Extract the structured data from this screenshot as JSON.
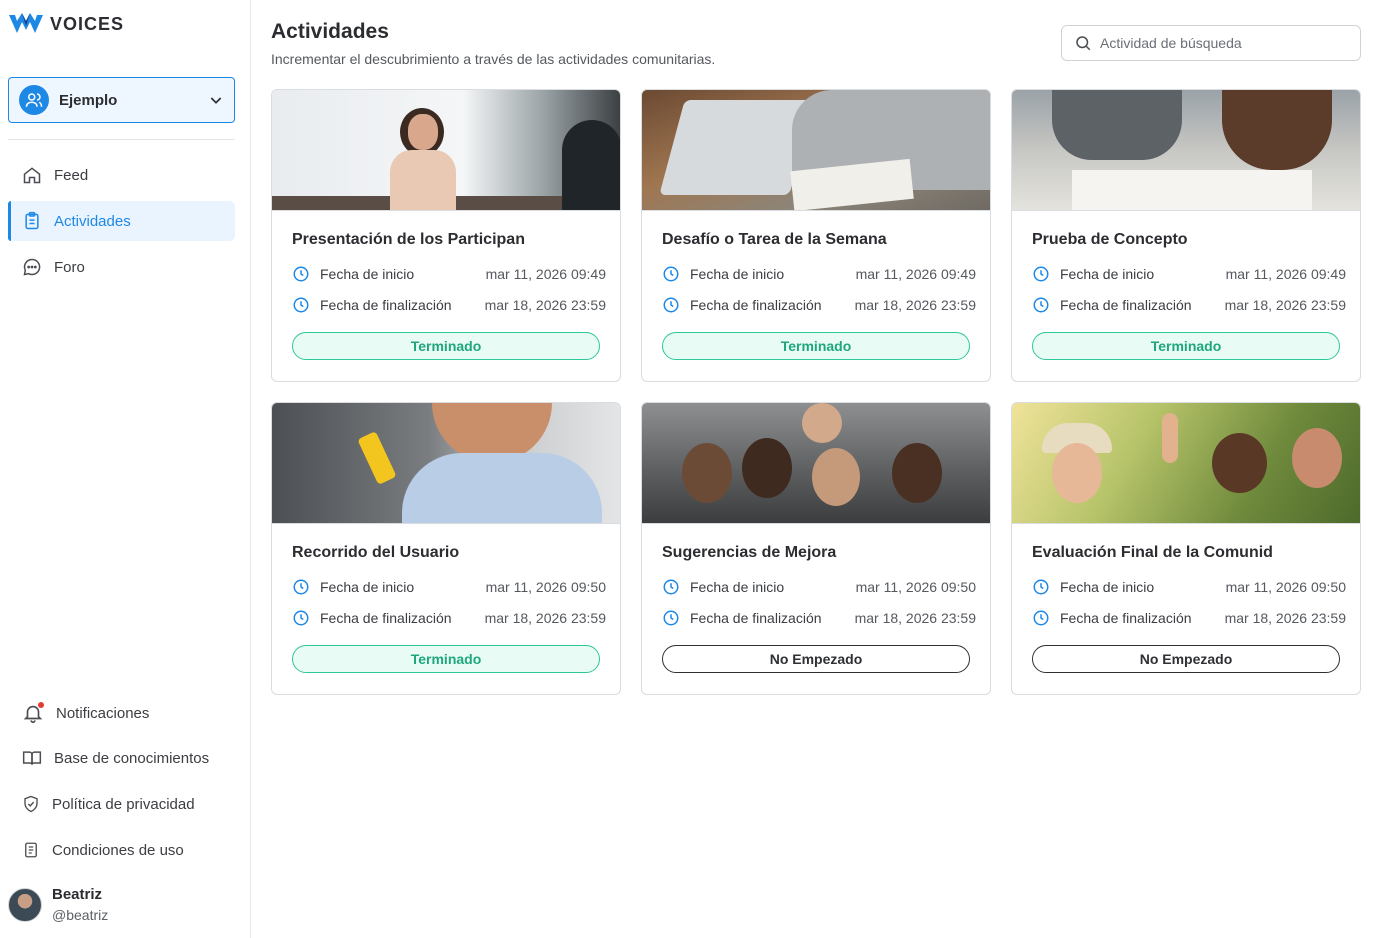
{
  "app": {
    "name": "VOICES"
  },
  "community": {
    "label": "Ejemplo"
  },
  "nav": [
    {
      "id": "feed",
      "label": "Feed",
      "icon": "home-icon",
      "active": false
    },
    {
      "id": "actividades",
      "label": "Actividades",
      "icon": "clipboard-icon",
      "active": true
    },
    {
      "id": "foro",
      "label": "Foro",
      "icon": "chat-bubble-icon",
      "active": false
    }
  ],
  "bottom_nav": [
    {
      "label": "Notificaciones",
      "icon": "bell-icon"
    },
    {
      "label": "Base de conocimientos",
      "icon": "book-icon"
    },
    {
      "label": "Política de privacidad",
      "icon": "shield-check-icon"
    },
    {
      "label": "Condiciones de uso",
      "icon": "document-icon"
    }
  ],
  "user": {
    "name": "Beatriz",
    "handle": "@beatriz"
  },
  "header": {
    "title": "Actividades",
    "subtitle": "Incrementar el descubrimiento a través de las actividades comunitarias.",
    "search_placeholder": "Actividad de búsqueda"
  },
  "labels": {
    "start": "Fecha de inicio",
    "end": "Fecha de finalización"
  },
  "activities": [
    {
      "title": "Presentación de los Participan",
      "start": "mar 11, 2026 09:49",
      "end": "mar 18, 2026 23:59",
      "status": "Terminado",
      "done": true,
      "image": "presenter-at-whiteboard"
    },
    {
      "title": "Desafío o Tarea de la Semana",
      "start": "mar 11, 2026 09:49",
      "end": "mar 18, 2026 23:59",
      "status": "Terminado",
      "done": true,
      "image": "laptop-and-notebook"
    },
    {
      "title": "Prueba de Concepto",
      "start": "mar 11, 2026 09:49",
      "end": "mar 18, 2026 23:59",
      "status": "Terminado",
      "done": true,
      "image": "people-writing-at-table"
    },
    {
      "title": "Recorrido del Usuario",
      "start": "mar 11, 2026 09:50",
      "end": "mar 18, 2026 23:59",
      "status": "Terminado",
      "done": true,
      "image": "woman-with-phone"
    },
    {
      "title": "Sugerencias de Mejora",
      "start": "mar 11, 2026 09:50",
      "end": "mar 18, 2026 23:59",
      "status": "No Empezado",
      "done": false,
      "image": "group-high-five"
    },
    {
      "title": "Evaluación Final de la Comunid",
      "start": "mar 11, 2026 09:50",
      "end": "mar 18, 2026 23:59",
      "status": "No Empezado",
      "done": false,
      "image": "friends-high-five-outdoors"
    }
  ],
  "colors": {
    "accent": "#1e88e5",
    "done": "#2ec79a",
    "done_bg": "#e8fbf5"
  }
}
